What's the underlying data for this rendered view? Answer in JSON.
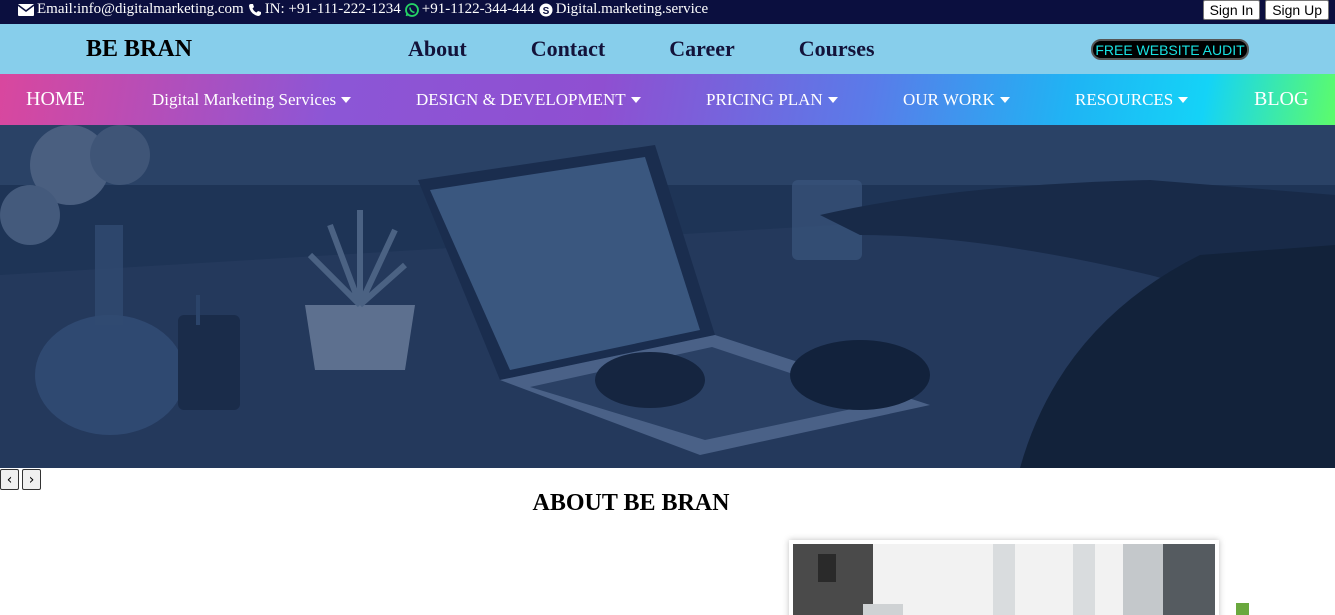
{
  "topbar": {
    "email": "Email:info@digitalmarketing.com",
    "phone": "IN: +91-111-222-1234",
    "whatsapp": "+91-1122-344-444",
    "skype": "Digital.marketing.service",
    "sign_in": "Sign In",
    "sign_up": "Sign Up",
    "icons": [
      "envelope-icon",
      "phone-icon",
      "whatsapp-icon",
      "skype-icon"
    ]
  },
  "brandbar": {
    "brand": "BE BRAN",
    "nav": [
      "About",
      "Contact",
      "Career",
      "Courses"
    ],
    "audit_button": "FREE WEBSITE AUDIT"
  },
  "gradnav": {
    "items": [
      {
        "label": "HOME",
        "dropdown": false
      },
      {
        "label": "Digital Marketing Services",
        "dropdown": true
      },
      {
        "label": "DESIGN & DEVELOPMENT",
        "dropdown": true
      },
      {
        "label": "PRICING PLAN",
        "dropdown": true
      },
      {
        "label": "OUR WORK",
        "dropdown": true
      },
      {
        "label": "RESOURCES",
        "dropdown": true
      },
      {
        "label": "BLOG",
        "dropdown": false
      }
    ]
  },
  "slider": {
    "prev": "‹",
    "next": "›"
  },
  "about": {
    "title": "ABOUT BE BRAN"
  },
  "colors": {
    "topbar": "#0b0f3f",
    "brandbar": "#87ceeb",
    "audit_text": "#19e2e2",
    "hero_overlay": "#1c3154",
    "accent_green": "#6aa83e"
  }
}
